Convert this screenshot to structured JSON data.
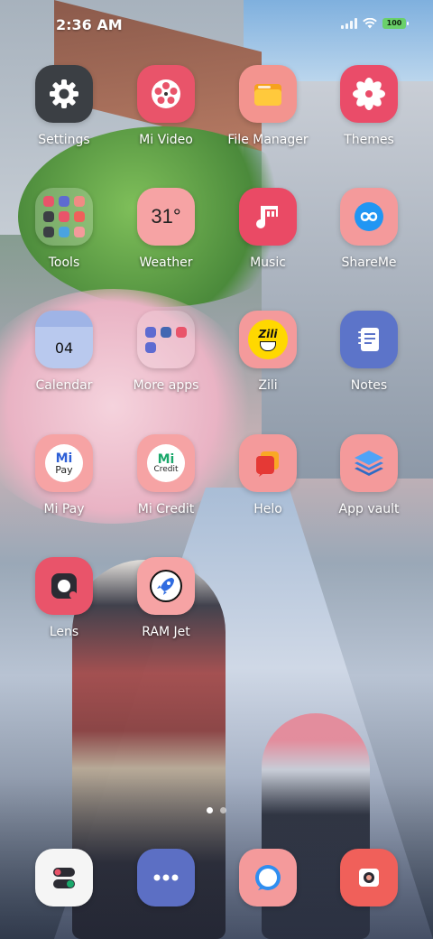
{
  "status_bar": {
    "time": "2:36 AM",
    "battery": "100"
  },
  "apps": [
    {
      "name": "settings",
      "label": "Settings",
      "color": "#3b3f44"
    },
    {
      "name": "mi-video",
      "label": "Mi Video",
      "color": "#e9546a"
    },
    {
      "name": "file-manager",
      "label": "File Manager",
      "color": "#f3948f"
    },
    {
      "name": "themes",
      "label": "Themes",
      "color": "#ea4c69"
    },
    {
      "name": "tools",
      "label": "Tools",
      "color": "folder"
    },
    {
      "name": "weather",
      "label": "Weather",
      "color": "#f6a3a4",
      "text": "31°"
    },
    {
      "name": "music",
      "label": "Music",
      "color": "#ea4a65"
    },
    {
      "name": "shareme",
      "label": "ShareMe",
      "color": "#f49a9b"
    },
    {
      "name": "calendar",
      "label": "Calendar",
      "color": "#b9c9ee",
      "text": "04"
    },
    {
      "name": "more-apps",
      "label": "More apps",
      "color": "folder"
    },
    {
      "name": "zili",
      "label": "Zili",
      "color": "#f49a9b",
      "text": "Zili"
    },
    {
      "name": "notes",
      "label": "Notes",
      "color": "#5c74c9"
    },
    {
      "name": "mi-pay",
      "label": "Mi Pay",
      "color": "#f6a3a4",
      "text": "Mi",
      "text2": "Pay"
    },
    {
      "name": "mi-credit",
      "label": "Mi Credit",
      "color": "#f6a3a4",
      "text": "Mi",
      "text2": "Credit"
    },
    {
      "name": "helo",
      "label": "Helo",
      "color": "#f49a9b"
    },
    {
      "name": "app-vault",
      "label": "App vault",
      "color": "#f49a9b"
    },
    {
      "name": "lens",
      "label": "Lens",
      "color": "#e9546a"
    },
    {
      "name": "ram-jet",
      "label": "RAM Jet",
      "color": "#f6a3a4"
    }
  ],
  "dock": [
    {
      "name": "phone",
      "color": "#f5f5f5"
    },
    {
      "name": "messaging",
      "color": "#5c6fc4"
    },
    {
      "name": "browser",
      "color": "#f49a9b"
    },
    {
      "name": "camera",
      "color": "#f0605a"
    }
  ]
}
